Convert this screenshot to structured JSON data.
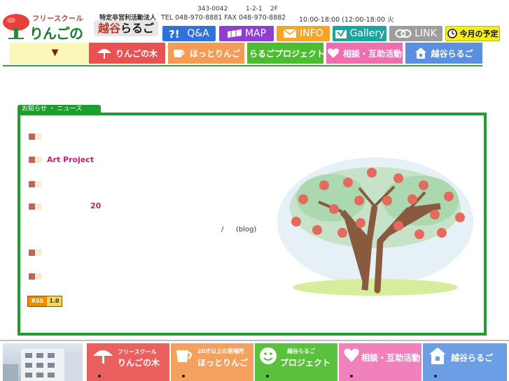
{
  "header": {
    "logo_sub": "フリースクール",
    "logo_main": "りんごの木",
    "npo_small": "特定非営利活動法人",
    "npo_main_a": "越谷",
    "npo_main_b": "らるご",
    "postal": "343-0042",
    "address": "1-2-1",
    "floor": "2F",
    "contact": "TEL 048-970-8881 FAX 048-970-8882",
    "hours": "10:00-18:00 (12:00-18:00 火"
  },
  "top_buttons": {
    "qa": "Q&A",
    "map": "MAP",
    "info": "INFO",
    "gallery": "Gallery",
    "link": "LINK",
    "schedule": "今月の予定"
  },
  "nav": {
    "arrow": "▼",
    "ringo": "りんごの木",
    "hotto": "ほっとりんご",
    "larugo": "らるごプロジェクト",
    "soudan": "相談・互助活動",
    "koshi": "越谷らるご"
  },
  "news": {
    "heading": "お知らせ ・ ニュース",
    "item2": "Art Project",
    "num": "20",
    "slash": "/",
    "blog": "(blog)",
    "rss_left": "RSS",
    "rss_right": "1.0"
  },
  "footer": {
    "ringo_sub": "フリースクール",
    "ringo_main": "りんごの木",
    "hotto_sub": "20才以上の居場所",
    "hotto_main": "ほっとりんご",
    "larugo_sub": "越谷らるご",
    "larugo_main": "プロジェクト",
    "soudan_main": "相談・互助活動",
    "koshi_main": "越谷らるご"
  },
  "colors": {
    "brand_green": "#1e9e2e",
    "accent_pink": "#c81e76",
    "nav_ringo": "#e85252",
    "nav_hotto": "#f49b54",
    "nav_larugo": "#4cbd2e",
    "nav_soudan": "#ee6eb1",
    "nav_koshi": "#5b8fe0"
  }
}
